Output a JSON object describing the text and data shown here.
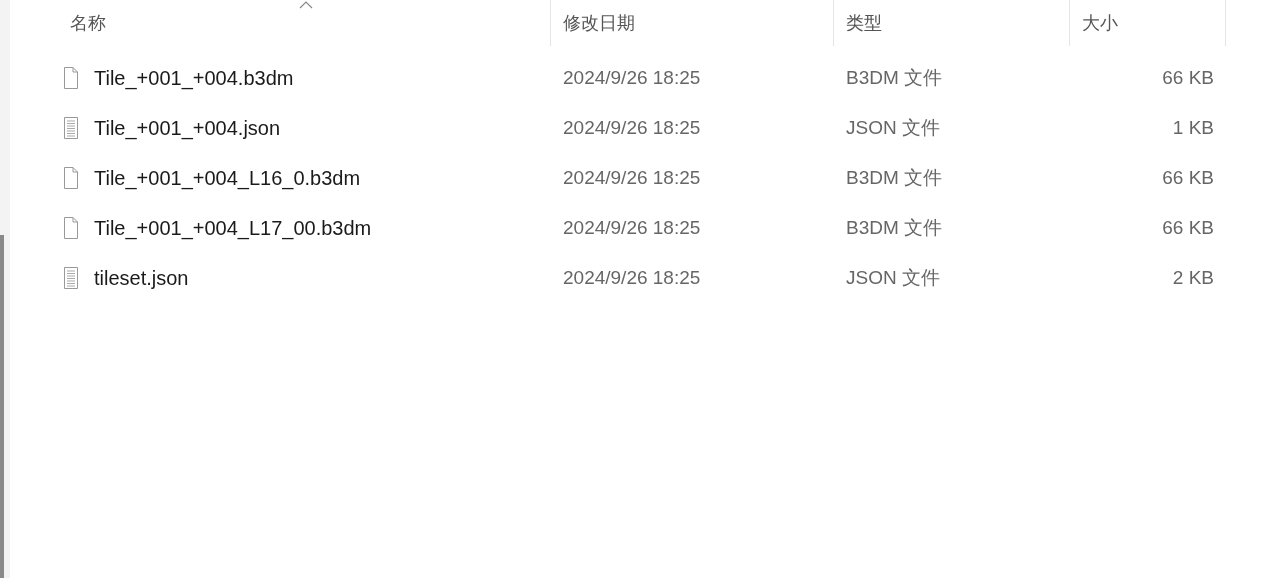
{
  "table": {
    "columns": [
      {
        "label": "名称",
        "sorted": true
      },
      {
        "label": "修改日期",
        "sorted": false
      },
      {
        "label": "类型",
        "sorted": false
      },
      {
        "label": "大小",
        "sorted": false
      }
    ],
    "rows": [
      {
        "kind": "blank",
        "name": "Tile_+001_+004.b3dm",
        "modified": "2024/9/26 18:25",
        "type": "B3DM 文件",
        "size": "66 KB"
      },
      {
        "kind": "text",
        "name": "Tile_+001_+004.json",
        "modified": "2024/9/26 18:25",
        "type": "JSON 文件",
        "size": "1 KB"
      },
      {
        "kind": "blank",
        "name": "Tile_+001_+004_L16_0.b3dm",
        "modified": "2024/9/26 18:25",
        "type": "B3DM 文件",
        "size": "66 KB"
      },
      {
        "kind": "blank",
        "name": "Tile_+001_+004_L17_00.b3dm",
        "modified": "2024/9/26 18:25",
        "type": "B3DM 文件",
        "size": "66 KB"
      },
      {
        "kind": "text",
        "name": "tileset.json",
        "modified": "2024/9/26 18:25",
        "type": "JSON 文件",
        "size": "2 KB"
      }
    ]
  }
}
